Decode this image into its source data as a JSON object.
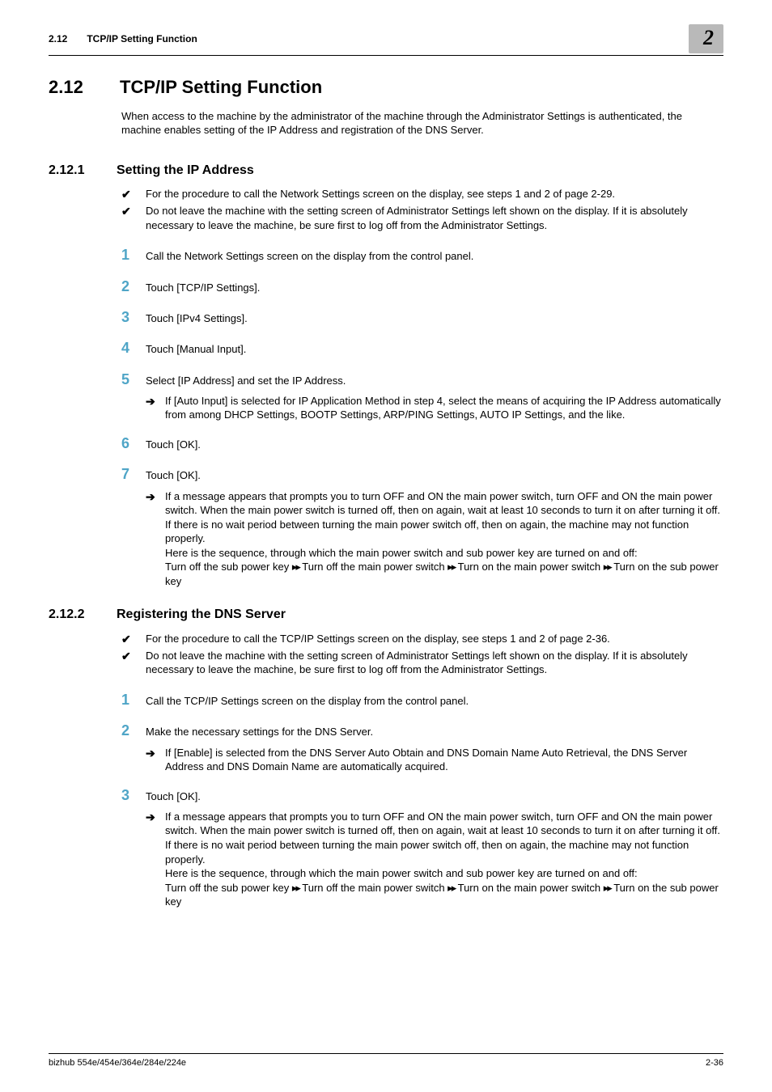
{
  "header": {
    "section_num": "2.12",
    "section_title": "TCP/IP Setting Function",
    "chapter_badge": "2"
  },
  "h1": {
    "num": "2.12",
    "title": "TCP/IP Setting Function"
  },
  "intro": "When access to the machine by the administrator of the machine through the Administrator Settings is authenticated, the machine enables setting of the IP Address and registration of the DNS Server.",
  "s1": {
    "num": "2.12.1",
    "title": "Setting the IP Address",
    "checks": [
      "For the procedure to call the Network Settings screen on the display, see steps 1 and 2 of page 2-29.",
      "Do not leave the machine with the setting screen of Administrator Settings left shown on the display. If it is absolutely necessary to leave the machine, be sure first to log off from the Administrator Settings."
    ],
    "steps": {
      "s1": "Call the Network Settings screen on the display from the control panel.",
      "s2": "Touch [TCP/IP Settings].",
      "s3": "Touch [IPv4 Settings].",
      "s4": "Touch [Manual Input].",
      "s5": "Select [IP Address] and set the IP Address.",
      "s5a": "If [Auto Input] is selected for IP Application Method in step 4, select the means of acquiring the IP Address automatically from among DHCP Settings, BOOTP Settings, ARP/PING Settings, AUTO IP Settings, and the like.",
      "s6": "Touch [OK].",
      "s7": "Touch [OK].",
      "s7a_p1": "If a message appears that prompts you to turn OFF and ON the main power switch, turn OFF and ON the main power switch. When the main power switch is turned off, then on again, wait at least 10 seconds to turn it on after turning it off. If there is no wait period between turning the main power switch off, then on again, the machine may not function properly.",
      "s7a_p2": "Here is the sequence, through which the main power switch and sub power key are turned on and off:",
      "s7a_seq_1": "Turn off the sub power key ",
      "s7a_seq_2": " Turn off the main power switch ",
      "s7a_seq_3": " Turn on the main power switch ",
      "s7a_seq_4": " Turn on the sub power key"
    }
  },
  "s2": {
    "num": "2.12.2",
    "title": "Registering the DNS Server",
    "checks": [
      "For the procedure to call the TCP/IP Settings screen on the display, see steps 1 and 2 of page 2-36.",
      "Do not leave the machine with the setting screen of Administrator Settings left shown on the display. If it is absolutely necessary to leave the machine, be sure first to log off from the Administrator Settings."
    ],
    "steps": {
      "s1": "Call the TCP/IP Settings screen on the display from the control panel.",
      "s2": "Make the necessary settings for the DNS Server.",
      "s2a": "If [Enable] is selected from the DNS Server Auto Obtain and DNS Domain Name Auto Retrieval, the DNS Server Address and DNS Domain Name are automatically acquired.",
      "s3": "Touch [OK].",
      "s3a_p1": "If a message appears that prompts you to turn OFF and ON the main power switch, turn OFF and ON the main power switch. When the main power switch is turned off, then on again, wait at least 10 seconds to turn it on after turning it off. If there is no wait period between turning the main power switch off, then on again, the machine may not function properly.",
      "s3a_p2": "Here is the sequence, through which the main power switch and sub power key are turned on and off:",
      "s3a_seq_1": "Turn off the sub power key ",
      "s3a_seq_2": " Turn off the main power switch ",
      "s3a_seq_3": " Turn on the main power switch ",
      "s3a_seq_4": " Turn on the sub power key"
    }
  },
  "footer": {
    "left": "bizhub 554e/454e/364e/284e/224e",
    "right": "2-36"
  },
  "glyphs": {
    "check": "✔",
    "arrow": "➔",
    "tri": "▸▸"
  }
}
